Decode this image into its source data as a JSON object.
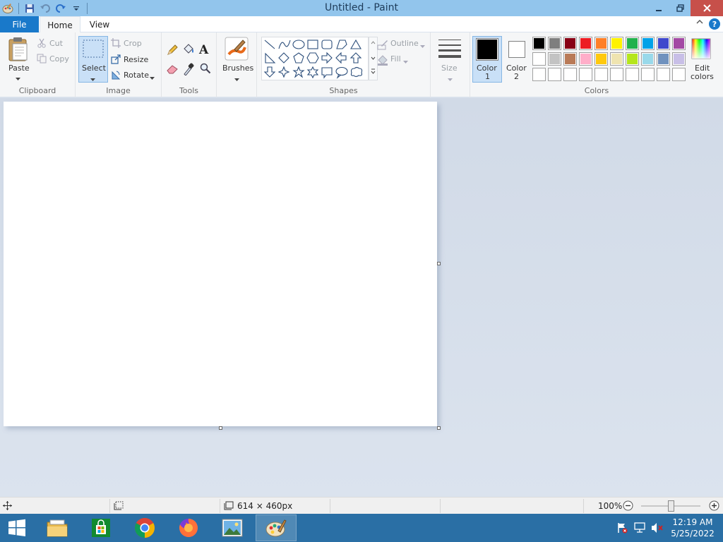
{
  "window": {
    "title": "Untitled - Paint"
  },
  "tabs": {
    "file": "File",
    "home": "Home",
    "view": "View"
  },
  "clipboard": {
    "paste": "Paste",
    "cut": "Cut",
    "copy": "Copy",
    "label": "Clipboard"
  },
  "image": {
    "select": "Select",
    "crop": "Crop",
    "resize": "Resize",
    "rotate": "Rotate",
    "label": "Image"
  },
  "tools": {
    "label": "Tools"
  },
  "brushes": {
    "label": "Brushes"
  },
  "shapes": {
    "outline": "Outline",
    "fill": "Fill",
    "label": "Shapes"
  },
  "size": {
    "label": "Size"
  },
  "colors": {
    "color1_line1": "Color",
    "color1_line2": "1",
    "color2_line1": "Color",
    "color2_line2": "2",
    "edit_line1": "Edit",
    "edit_line2": "colors",
    "label": "Colors",
    "color1": "#000000",
    "color2": "#ffffff",
    "row1": [
      "#000000",
      "#7f7f7f",
      "#880015",
      "#ed1c24",
      "#ff7f27",
      "#fff200",
      "#22b14c",
      "#00a2e8",
      "#3f48cc",
      "#a349a4"
    ],
    "row2": [
      "#ffffff",
      "#c3c3c3",
      "#b97a57",
      "#ffaec9",
      "#ffc90e",
      "#efe4b0",
      "#b5e61d",
      "#99d9ea",
      "#7092be",
      "#c8bfe7"
    ],
    "row3": [
      "#ffffff",
      "#ffffff",
      "#ffffff",
      "#ffffff",
      "#ffffff",
      "#ffffff",
      "#ffffff",
      "#ffffff",
      "#ffffff",
      "#ffffff"
    ]
  },
  "status": {
    "dimensions": "614 × 460px",
    "zoom": "100%"
  },
  "taskbar": {
    "time": "12:19 AM",
    "date": "5/25/2022"
  }
}
